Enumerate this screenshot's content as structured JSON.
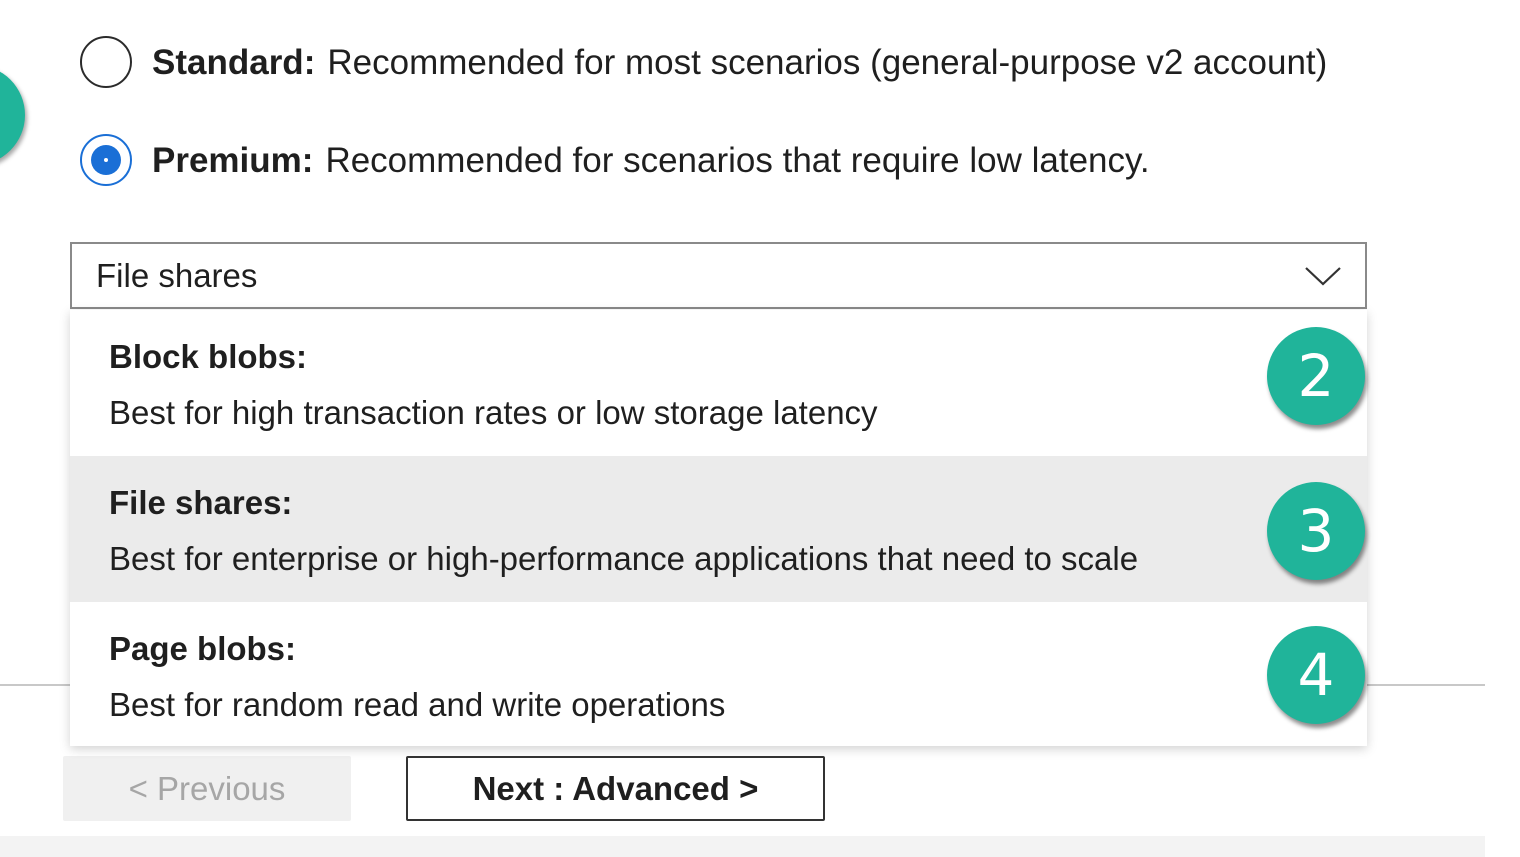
{
  "performance": {
    "standard": {
      "title": "Standard:",
      "description": "Recommended for most scenarios (general-purpose v2 account)",
      "checked": false
    },
    "premium": {
      "title": "Premium:",
      "description": "Recommended for scenarios that require low latency.",
      "checked": true
    }
  },
  "account_type": {
    "selected_value": "File shares",
    "options": [
      {
        "title": "Block blobs:",
        "description": "Best for high transaction rates or low storage latency",
        "callout": "2",
        "selected": false
      },
      {
        "title": "File shares:",
        "description": "Best for enterprise or high-performance applications that need to scale",
        "callout": "3",
        "selected": true
      },
      {
        "title": "Page blobs:",
        "description": "Best for random read and write operations",
        "callout": "4",
        "selected": false
      }
    ]
  },
  "footer": {
    "previous_label": "< Previous",
    "next_label": "Next : Advanced >"
  },
  "colors": {
    "callout": "#20b49a",
    "radio_selected": "#1a6fd6",
    "selected_option_bg": "#ebebeb"
  }
}
